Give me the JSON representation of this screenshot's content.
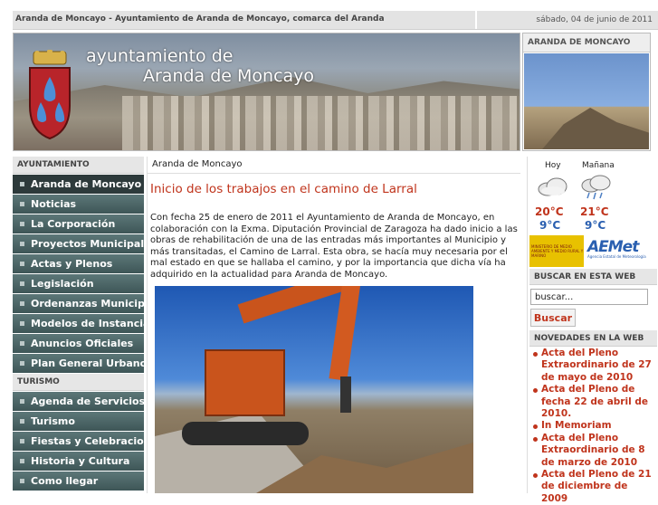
{
  "topbar": {
    "title": "Aranda de Moncayo - Ayuntamiento de Aranda de Moncayo, comarca del Aranda",
    "date": "sábado, 04 de junio de 2011"
  },
  "banner": {
    "line1": "ayuntamiento de",
    "line2": "Aranda de Moncayo"
  },
  "side_image": {
    "title": "ARANDA DE MONCAYO"
  },
  "left_nav": {
    "section1": "AYUNTAMIENTO",
    "items1": [
      "Aranda de Moncayo",
      "Noticias",
      "La Corporación",
      "Proyectos Municipales",
      "Actas y Plenos",
      "Legislación",
      "Ordenanzas Municipales",
      "Modelos de Instancias",
      "Anuncios Oficiales",
      "Plan General Urbano"
    ],
    "section2": "TURISMO",
    "items2": [
      "Agenda de Servicios",
      "Turismo",
      "Fiestas y Celebraciones",
      "Historia y Cultura",
      "Como llegar"
    ]
  },
  "content": {
    "breadcrumb": "Aranda de Moncayo",
    "headline": "Inicio de los trabajos en el camino de Larral",
    "paragraph": "Con fecha 25 de enero de 2011 el Ayuntamiento de Aranda de Moncayo, en colaboración con la Exma. Diputación Provincial de Zaragoza ha dado inicio a las obras de rehabilitación de una de las entradas más importantes al Municipio y más transitadas, el Camino de Larral. Esta obra, se hacía muy necesaria por el mal estado en que se hallaba el camino, y por la importancia que dicha vía ha adquirido en la actualidad para Aranda de Moncayo."
  },
  "weather": {
    "today": {
      "label": "Hoy",
      "high": "20°C",
      "low": "9°C",
      "icon": "cloud-icon"
    },
    "tomorrow": {
      "label": "Mañana",
      "high": "21°C",
      "low": "9°C",
      "icon": "rain-cloud-icon"
    },
    "ministry_text": "MINISTERIO DE MEDIO AMBIENTE Y MEDIO RURAL Y MARINO",
    "aemet_logo": "AEMet",
    "aemet_sub": "Agencia Estatal de Meteorología"
  },
  "search": {
    "title": "BUSCAR EN ESTA WEB",
    "value": "buscar...",
    "button": "Buscar"
  },
  "news": {
    "title": "NOVEDADES EN LA WEB",
    "items": [
      "Acta del Pleno Extraordinario de 27 de mayo de 2010",
      "Acta del Pleno de fecha 22 de abril de 2010.",
      "In Memoriam",
      "Acta del Pleno Extraordinario de 8 de marzo de 2010",
      "Acta del Pleno de 21 de diciembre de 2009"
    ]
  },
  "colors": {
    "accent": "#c0341c",
    "nav": "#4b6465",
    "temp_low": "#2a5fb0"
  }
}
